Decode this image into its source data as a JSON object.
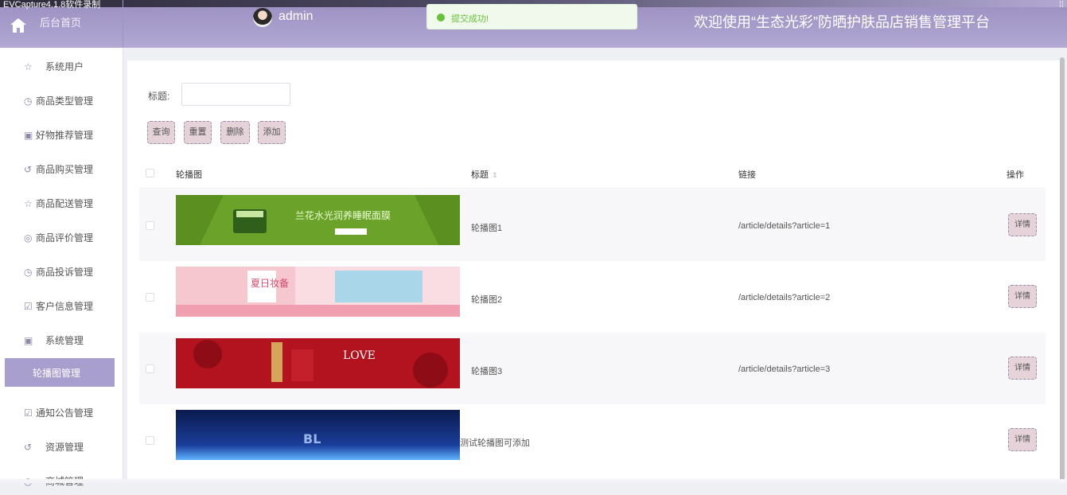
{
  "capture_title": "EVCapture4.1.8软件录制",
  "header": {
    "home_label": "后台首页",
    "user": "admin",
    "toast": "提交成功!",
    "site_title": "欢迎使用“生态光彩”防晒护肤品店销售管理平台",
    "accent": "#a99fce"
  },
  "sidebar": {
    "items": [
      {
        "label": "系统用户",
        "icon": "star-icon"
      },
      {
        "label": "商品类型管理",
        "icon": "clock-icon"
      },
      {
        "label": "好物推荐管理",
        "icon": "gift-icon"
      },
      {
        "label": "商品购买管理",
        "icon": "refresh-icon"
      },
      {
        "label": "商品配送管理",
        "icon": "star-icon"
      },
      {
        "label": "商品评价管理",
        "icon": "compass-icon"
      },
      {
        "label": "商品投诉管理",
        "icon": "clock-icon"
      },
      {
        "label": "客户信息管理",
        "icon": "calendar-icon"
      },
      {
        "label": "系统管理",
        "icon": "gift-icon"
      },
      {
        "label": "轮播图管理",
        "icon": ""
      },
      {
        "label": "通知公告管理",
        "icon": "calendar-icon"
      },
      {
        "label": "资源管理",
        "icon": "refresh-icon"
      },
      {
        "label": "商城管理",
        "icon": "clock-icon"
      }
    ]
  },
  "search": {
    "label": "标题:",
    "value": ""
  },
  "buttons": {
    "query": "查询",
    "reset": "重置",
    "delete": "删除",
    "add": "添加"
  },
  "table": {
    "headers": {
      "banner": "轮播图",
      "title": "标题",
      "link": "链接",
      "action": "操作"
    },
    "detail_label": "详情",
    "rows": [
      {
        "title": "轮播图1",
        "link": "/article/details?article=1",
        "image_text": "兰花水光润养睡眠面膜"
      },
      {
        "title": "轮播图2",
        "link": "/article/details?article=2",
        "image_text": "夏日妆备"
      },
      {
        "title": "轮播图3",
        "link": "/article/details?article=3",
        "image_text": "LOVE"
      },
      {
        "title": "测试轮播图可添加",
        "link": "",
        "image_text": "BL"
      }
    ]
  }
}
